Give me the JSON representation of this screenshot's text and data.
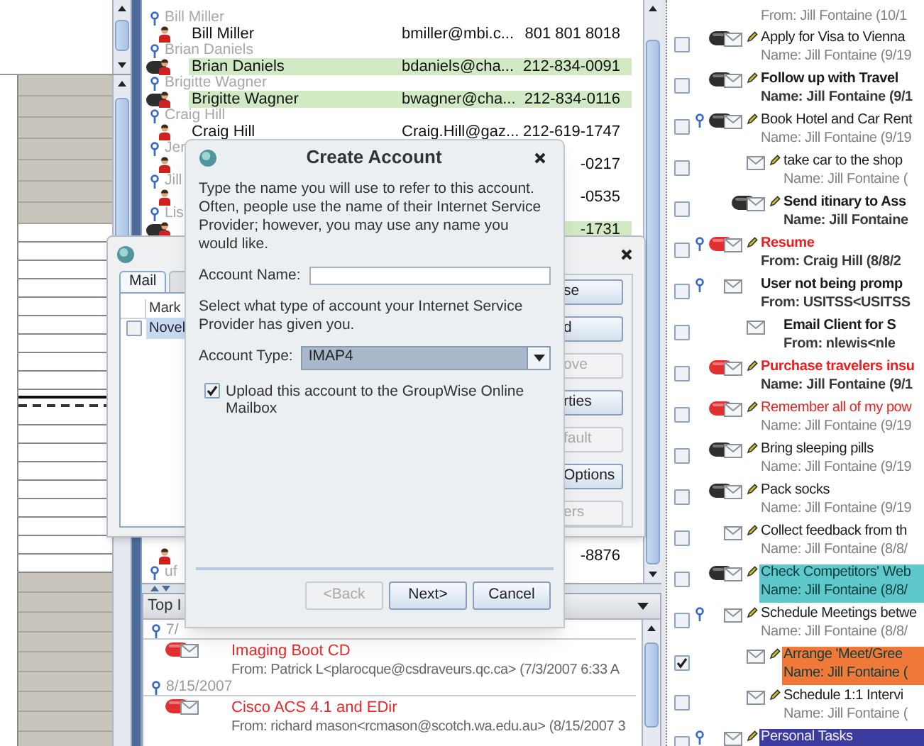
{
  "contacts": {
    "upper": [
      {
        "group": "Bill Miller",
        "name": "Bill Miller",
        "email": "bmiller@mbi.c...",
        "phone": "801 801 8018",
        "online": false,
        "selected": false
      },
      {
        "group": "Brian Daniels",
        "name": "Brian Daniels",
        "email": "bdaniels@cha...",
        "phone": "212-834-0091",
        "online": true,
        "selected": true
      },
      {
        "group": "Brigitte Wagner",
        "name": "Brigitte Wagner",
        "email": "bwagner@cha...",
        "phone": "212-834-0116",
        "online": true,
        "selected": true
      },
      {
        "group": "Craig Hill",
        "name": "Craig Hill",
        "email": "Craig.Hill@gaz...",
        "phone": "212-619-1747",
        "online": false,
        "selected": false
      },
      {
        "group": "Jer",
        "phone": "-0217",
        "online": false,
        "selected": false
      },
      {
        "group": "Jill",
        "phone": "-0535",
        "online": false,
        "selected": false
      },
      {
        "group": "Lis",
        "phone": "-1731",
        "online": true,
        "selected": true
      }
    ],
    "lower": [
      {
        "phone": "-8876",
        "online": false,
        "selected": false
      },
      {
        "group": "uf"
      }
    ]
  },
  "folder_pane": {
    "header": "Top I",
    "groups": [
      {
        "date": "7/",
        "items": [
          {
            "pill": true,
            "high_priority": true,
            "title": "Imaging Boot CD",
            "from": "From: Patrick L<plarocque@csdraveurs.qc.ca> (7/3/2007 6:33 A"
          }
        ]
      },
      {
        "date": "8/15/2007",
        "items": [
          {
            "pill": true,
            "high_priority": true,
            "title": "Cisco ACS 4.1 and EDir",
            "from": "From: richard mason<rcmason@scotch.wa.edu.au> (8/15/2007 3"
          }
        ]
      }
    ]
  },
  "task_list": [
    {
      "subtitle": "From: Jill Fontaine (10/1"
    },
    {
      "checked": false,
      "pinned": false,
      "pill": true,
      "high_priority": false,
      "note": true,
      "unread": false,
      "title": "Apply for Visa to Vienna",
      "subtitle": "Name: Jill Fontaine (9/19"
    },
    {
      "checked": false,
      "pinned": false,
      "pill": true,
      "high_priority": false,
      "note": true,
      "unread": true,
      "title": "Follow up with Travel",
      "subtitle": "Name: Jill Fontaine (9/1"
    },
    {
      "checked": false,
      "pinned": true,
      "pill": true,
      "high_priority": false,
      "note": true,
      "unread": false,
      "title": "Book Hotel and Car Rent",
      "subtitle": "Name: Jill Fontaine (9/19",
      "children": [
        {
          "checked": false,
          "pinned": false,
          "pill": false,
          "high_priority": false,
          "note": true,
          "unread": false,
          "title": "take car to the shop",
          "subtitle": "Name: Jill Fontaine ("
        },
        {
          "checked": false,
          "pinned": false,
          "pill": true,
          "high_priority": false,
          "note": true,
          "unread": true,
          "title": "Send itinary to Ass",
          "subtitle": "Name: Jill Fontaine"
        }
      ]
    },
    {
      "checked": false,
      "pinned": true,
      "pill": true,
      "high_priority": true,
      "note": true,
      "unread": true,
      "title": "Resume",
      "subtitle": "From: Craig Hill (8/8/2"
    },
    {
      "checked": false,
      "pinned": true,
      "pill": false,
      "high_priority": false,
      "note": false,
      "unread": true,
      "title": "User not being promp",
      "subtitle": "From: USITSS<USITSS",
      "children": [
        {
          "checked": false,
          "pinned": false,
          "pill": false,
          "high_priority": false,
          "note": false,
          "unread": true,
          "title": "Email Client for S",
          "subtitle": "From: nlewis<nle"
        }
      ]
    },
    {
      "checked": false,
      "pinned": false,
      "pill": true,
      "high_priority": true,
      "note": true,
      "unread": true,
      "title": "Purchase travelers insu",
      "subtitle": "Name: Jill Fontaine (9/1"
    },
    {
      "checked": false,
      "pinned": false,
      "pill": true,
      "high_priority": true,
      "note": true,
      "unread": false,
      "title": "Remember all of my pow",
      "subtitle": "Name: Jill Fontaine (9/19"
    },
    {
      "checked": false,
      "pinned": false,
      "pill": true,
      "high_priority": false,
      "note": true,
      "unread": false,
      "title": "Bring sleeping pills",
      "subtitle": "Name: Jill Fontaine (9/19"
    },
    {
      "checked": false,
      "pinned": false,
      "pill": true,
      "high_priority": false,
      "note": true,
      "unread": false,
      "title": "Pack socks",
      "subtitle": "Name: Jill Fontaine (9/19"
    },
    {
      "checked": false,
      "pinned": false,
      "pill": false,
      "high_priority": false,
      "note": true,
      "unread": false,
      "title": "Collect feedback from th",
      "subtitle": "Name: Jill Fontaine (8/8/"
    },
    {
      "checked": false,
      "pinned": false,
      "pill": true,
      "high_priority": false,
      "note": true,
      "unread": false,
      "color": "#5ec8cc",
      "title": "Check Competitors' Web",
      "subtitle": "Name: Jill Fontaine (8/8/"
    },
    {
      "checked": false,
      "pinned": true,
      "pill": false,
      "high_priority": false,
      "note": true,
      "unread": false,
      "title": "Schedule Meetings betwe",
      "subtitle": "Name: Jill Fontaine (8/8/",
      "children": [
        {
          "checked": true,
          "pinned": false,
          "pill": false,
          "high_priority": false,
          "note": true,
          "unread": false,
          "color": "#f07838",
          "title": "Arrange 'Meet/Gree",
          "subtitle": "Name: Jill Fontaine ("
        },
        {
          "checked": false,
          "pinned": false,
          "pill": false,
          "high_priority": false,
          "note": true,
          "unread": false,
          "title": "Schedule 1:1 Intervi",
          "subtitle": "Name: Jill Fontaine ("
        }
      ]
    },
    {
      "checked": false,
      "pinned": true,
      "pill": false,
      "high_priority": false,
      "note": true,
      "unread": false,
      "color": "#3c3ca0",
      "title": "Personal Tasks"
    }
  ],
  "accounts_dialog": {
    "tabs": [
      {
        "label": "Mail",
        "selected": true
      },
      {
        "selected": false
      }
    ],
    "table": {
      "columns": [
        "Mark"
      ],
      "rows": [
        {
          "label": "Novel",
          "checked": false,
          "selected": true
        }
      ]
    },
    "buttons": [
      {
        "label": "se",
        "disabled": false
      },
      {
        "label": "d",
        "disabled": false
      },
      {
        "label": "ove",
        "disabled": true
      },
      {
        "label": "rties",
        "disabled": false
      },
      {
        "label": "fault",
        "disabled": true
      },
      {
        "label": "Options",
        "disabled": false
      },
      {
        "label": "ers",
        "disabled": true
      }
    ]
  },
  "create_account_dialog": {
    "title": "Create Account",
    "description": "Type the name you will use to refer to this account. Often, people use the name of their Internet Service Provider; however, you may use any name you would like.",
    "account_name": {
      "label": "Account Name:"
    },
    "type_prompt": "Select what type of account your Internet Service Provider has given you.",
    "account_type": {
      "label": "Account Type:",
      "value": "IMAP4"
    },
    "upload": {
      "label": "Upload this account to the GroupWise Online Mailbox",
      "checked": true
    },
    "buttons": [
      {
        "label": "<Back",
        "disabled": true
      },
      {
        "label": "Next>",
        "disabled": false
      },
      {
        "label": "Cancel",
        "disabled": false
      }
    ]
  }
}
